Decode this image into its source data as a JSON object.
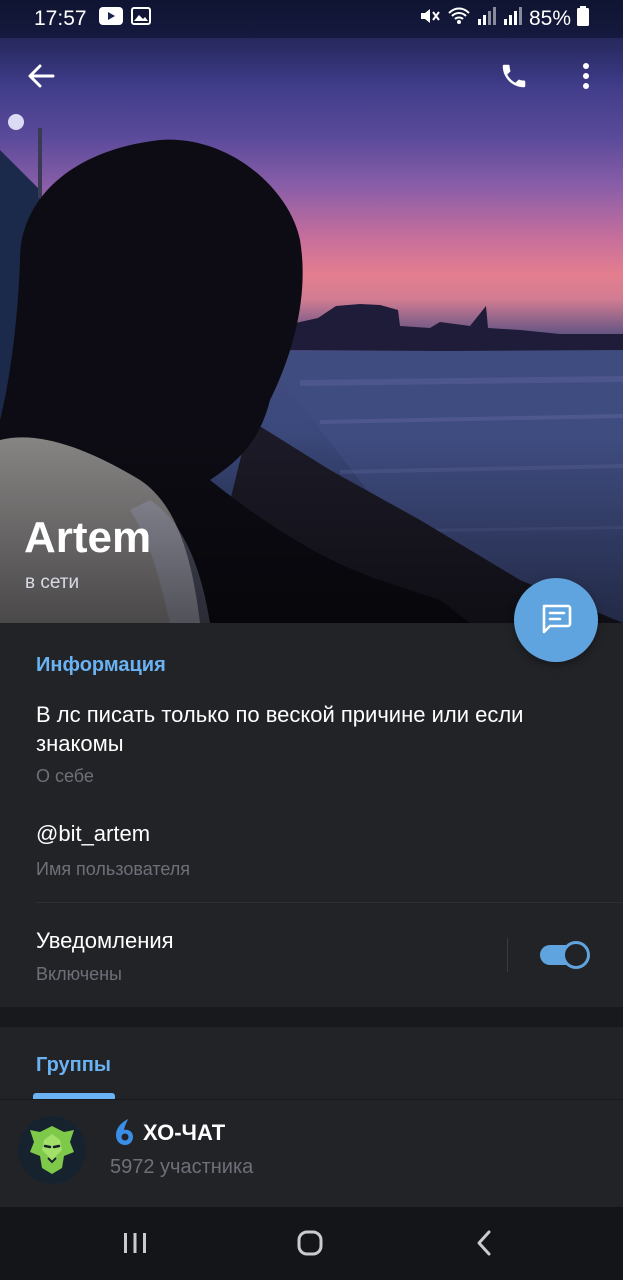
{
  "statusbar": {
    "time": "17:57",
    "battery": "85%",
    "icons": [
      "youtube-icon",
      "gallery-icon",
      "mute-icon",
      "wifi-icon",
      "signal-icon",
      "signal-icon",
      "battery-icon"
    ]
  },
  "topbar": {
    "icons": [
      "back-arrow-icon",
      "phone-icon",
      "more-vert-icon"
    ]
  },
  "profile": {
    "name": "Artem",
    "status": "в сети"
  },
  "info": {
    "section_title": "Информация",
    "bio": "В лс писать только по веской причине или если знакомы",
    "bio_label": "О себе",
    "username": "@bit_artem",
    "username_label": "Имя пользователя",
    "notifications": "Уведомления",
    "notifications_state": "Включены",
    "notifications_on": true
  },
  "groups": {
    "section_title": "Группы",
    "items": [
      {
        "name": "ХО-ЧАТ",
        "members": "5972 участника"
      }
    ]
  },
  "navbar": {
    "icons": [
      "recent-apps-icon",
      "home-icon",
      "back-icon"
    ]
  },
  "colors": {
    "accent": "#6ab2f2",
    "fab": "#5fa4de",
    "panel": "#222327",
    "background": "#18191d",
    "secondary_text": "#6d7079"
  }
}
